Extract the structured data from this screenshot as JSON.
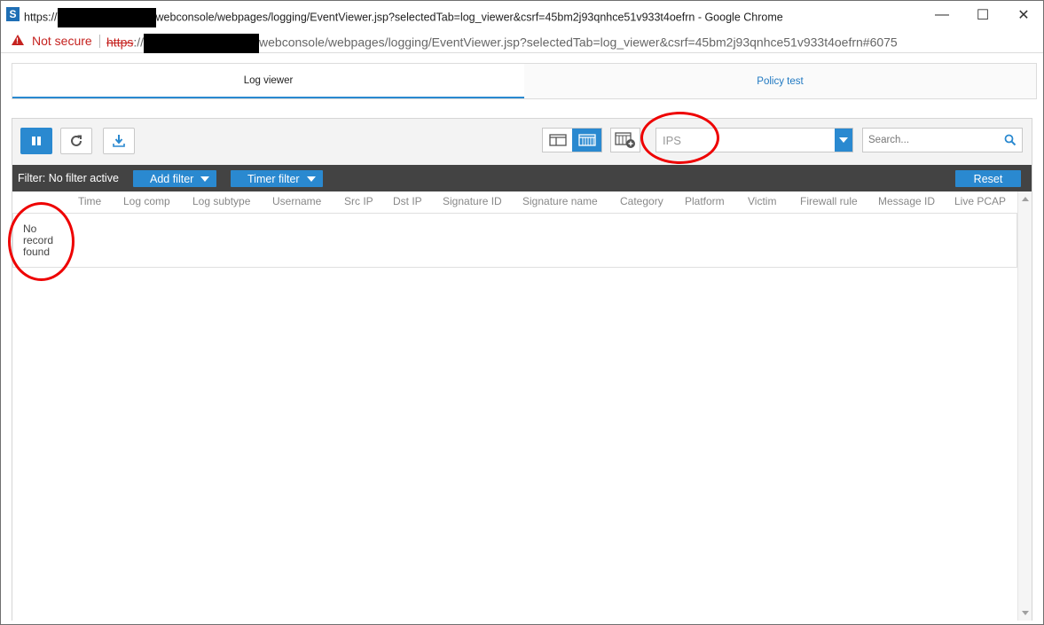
{
  "browser": {
    "title_prefix": "https://",
    "title_suffix": "webconsole/webpages/logging/EventViewer.jsp?selectedTab=log_viewer&csrf=45bm2j93qnhce51v933t4oefrn - Google Chrome",
    "security_label": "Not secure",
    "url_scheme": "https",
    "url_sep": "://",
    "url_rest": "webconsole/webpages/logging/EventViewer.jsp?selectedTab=log_viewer&csrf=45bm2j93qnhce51v933t4oefrn#6075",
    "app_icon_letter": "S",
    "minimize_glyph": "—",
    "maximize_glyph": "☐",
    "close_glyph": "✕"
  },
  "tabs": [
    {
      "label": "Log viewer",
      "active": true
    },
    {
      "label": "Policy test",
      "active": false
    }
  ],
  "toolbar": {
    "module_select_value": "IPS",
    "search_placeholder": "Search..."
  },
  "filter_bar": {
    "label": "Filter: No filter active",
    "add_filter": "Add filter",
    "timer_filter": "Timer filter",
    "reset": "Reset"
  },
  "table": {
    "columns": [
      "Time",
      "Log comp",
      "Log subtype",
      "Username",
      "Src IP",
      "Dst IP",
      "Signature ID",
      "Signature name",
      "Category",
      "Platform",
      "Victim",
      "Firewall rule",
      "Message ID",
      "Live PCAP"
    ],
    "empty_message": "No record found"
  },
  "colors": {
    "accent": "#2a89d0",
    "filter_bar_bg": "#434343",
    "annotation": "#e00000",
    "warning": "#c5221f"
  },
  "icons": [
    "pause-icon",
    "refresh-icon",
    "download-icon",
    "split-view-icon",
    "grid-view-icon",
    "column-add-icon",
    "search-icon",
    "warning-icon"
  ]
}
